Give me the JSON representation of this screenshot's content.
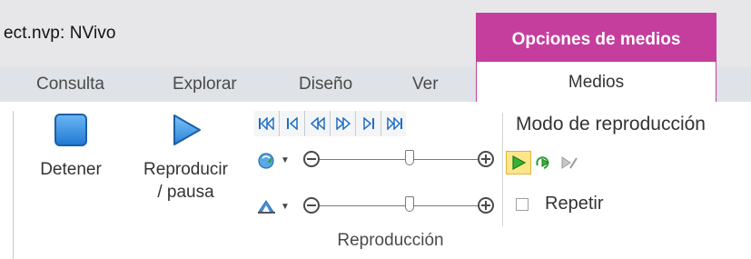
{
  "window": {
    "title": "ect.nvp: NVivo",
    "context_header": "Opciones de medios"
  },
  "tabs": [
    {
      "label": "Consulta"
    },
    {
      "label": "Explorar"
    },
    {
      "label": "Diseño"
    },
    {
      "label": "Ver"
    }
  ],
  "active_tab": {
    "label": "Medios"
  },
  "ribbon": {
    "stop_label": "Detener",
    "play_label_line1": "Reproducir",
    "play_label_line2": "/ pausa",
    "group_label": "Reproducción",
    "speed_slider_level": 0.57,
    "volume_slider_level": 0.57,
    "mode": {
      "title": "Modo de reproducción",
      "repeat_label": "Repetir",
      "repeat_checked": false
    }
  },
  "colors": {
    "accent": "#c53e9e",
    "stop_fill": "#3b8fe0",
    "play_fill": "#3b8fe0",
    "active_mode_bg": "#fde58a"
  },
  "icons": {
    "transport": [
      "skip-to-start-icon",
      "previous-icon",
      "rewind-icon",
      "fast-forward-icon",
      "next-icon",
      "skip-to-end-icon"
    ]
  }
}
